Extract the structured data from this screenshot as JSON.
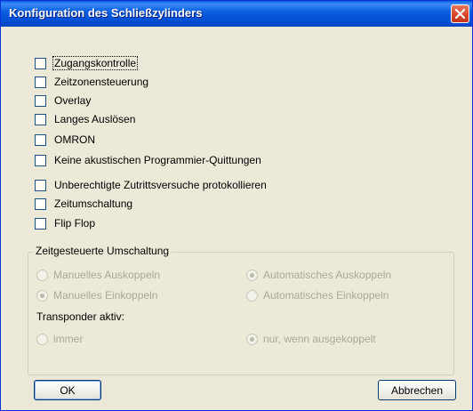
{
  "window": {
    "title": "Konfiguration des Schließzylinders"
  },
  "checkboxes": [
    {
      "label": "Zugangskontrolle",
      "checked": false
    },
    {
      "label": "Zeitzonensteuerung",
      "checked": false
    },
    {
      "label": "Overlay",
      "checked": false
    },
    {
      "label": "Langes Auslösen",
      "checked": false
    },
    {
      "label": "OMRON",
      "checked": false
    },
    {
      "label": "Keine akustischen Programmier-Quittungen",
      "checked": false
    },
    {
      "label": "Unberechtigte Zutrittsversuche protokollieren",
      "checked": false
    },
    {
      "label": "Zeitumschaltung",
      "checked": false
    },
    {
      "label": "Flip Flop",
      "checked": false
    }
  ],
  "group": {
    "title": "Zeitgesteuerte Umschaltung",
    "radios": [
      {
        "label": "Manuelles Auskoppeln",
        "checked": false
      },
      {
        "label": "Automatisches Auskoppeln",
        "checked": true
      },
      {
        "label": "Manuelles Einkoppeln",
        "checked": true
      },
      {
        "label": "Automatisches Einkoppeln",
        "checked": false
      }
    ],
    "transponder_label": "Transponder aktiv:",
    "transponder_radios": [
      {
        "label": "immer",
        "checked": false
      },
      {
        "label": "nur, wenn ausgekoppelt",
        "checked": true
      }
    ]
  },
  "buttons": {
    "ok": "OK",
    "cancel": "Abbrechen"
  }
}
